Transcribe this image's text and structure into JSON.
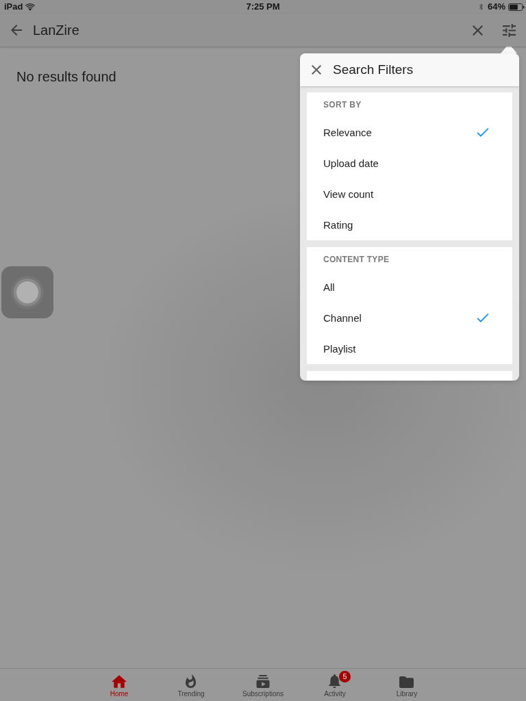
{
  "status_bar": {
    "carrier": "iPad",
    "time": "7:25 PM",
    "battery": "64%"
  },
  "search_bar": {
    "query": "LanZire"
  },
  "message": "No results found",
  "filter_panel": {
    "title": "Search Filters",
    "sections": [
      {
        "heading": "SORT BY",
        "options": [
          {
            "label": "Relevance",
            "selected": true
          },
          {
            "label": "Upload date",
            "selected": false
          },
          {
            "label": "View count",
            "selected": false
          },
          {
            "label": "Rating",
            "selected": false
          }
        ]
      },
      {
        "heading": "CONTENT TYPE",
        "options": [
          {
            "label": "All",
            "selected": false
          },
          {
            "label": "Channel",
            "selected": true
          },
          {
            "label": "Playlist",
            "selected": false
          }
        ]
      }
    ]
  },
  "tabs": [
    {
      "kind": "home",
      "label": "Home",
      "selected": true
    },
    {
      "kind": "trending",
      "label": "Trending",
      "selected": false
    },
    {
      "kind": "subscriptions",
      "label": "Subscriptions",
      "selected": false
    },
    {
      "kind": "activity",
      "label": "Activity",
      "selected": false,
      "badge": "5"
    },
    {
      "kind": "library",
      "label": "Library",
      "selected": false
    }
  ]
}
